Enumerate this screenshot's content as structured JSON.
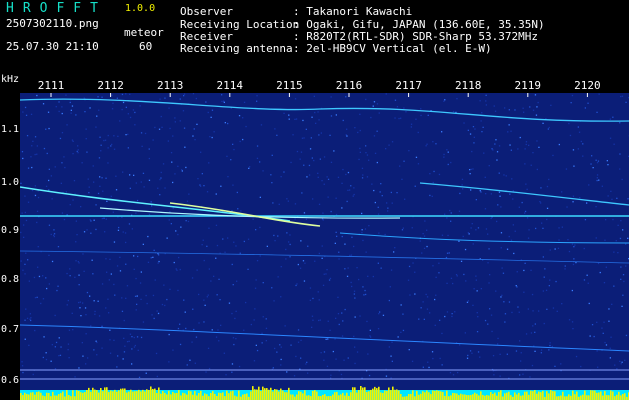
{
  "app": {
    "name": "HROFFT",
    "version": "1.0.0"
  },
  "file": {
    "name": "2507302110.png",
    "datetime": "25.07.30 21:10"
  },
  "detection": {
    "label": "meteor",
    "count": "60"
  },
  "station": {
    "observer_label": "Observer",
    "observer": ": Takanori Kawachi",
    "location_label": "Receiving Location",
    "location": ": Ogaki, Gifu, JAPAN (136.60E, 35.35N)",
    "receiver_label": "Receiver",
    "receiver": ": R820T2(RTL-SDR) SDR-Sharp 53.372MHz",
    "antenna_label": "Receiving antenna",
    "antenna": ": 2el-HB9CV Vertical (el. E-W)"
  },
  "axes": {
    "y_unit": "kHz",
    "y_ticks": [
      "1.1",
      "1.0",
      "0.9",
      "0.8",
      "0.7",
      "0.6"
    ],
    "x_ticks": [
      "2111",
      "2112",
      "2113",
      "2114",
      "2115",
      "2116",
      "2117",
      "2118",
      "2119",
      "2120"
    ]
  },
  "colors": {
    "background": "#0b1e78",
    "text": "#ffffff",
    "title": "#16e0c8",
    "accent": "#f2f200",
    "signal": "#00e6ff"
  }
}
